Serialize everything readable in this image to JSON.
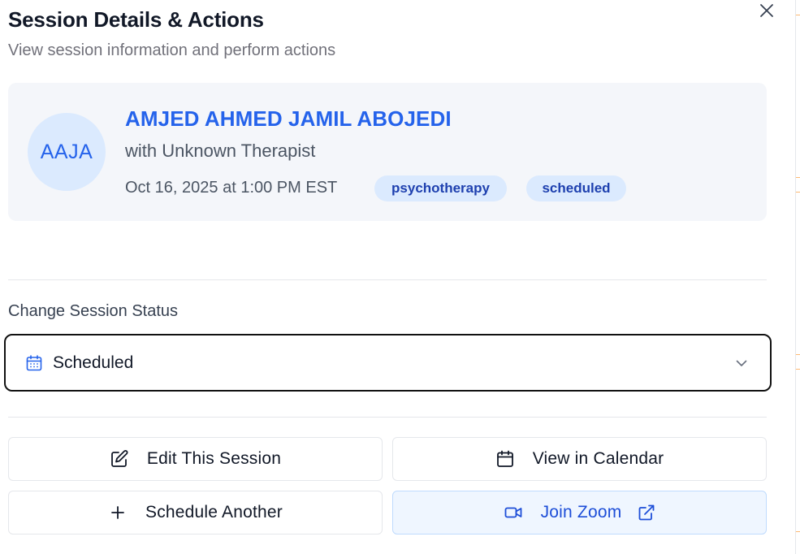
{
  "dialog": {
    "title": "Session Details & Actions",
    "subtitle": "View session information and perform actions",
    "close_icon": "close-icon"
  },
  "session": {
    "avatar_initials": "AAJA",
    "client_name": "AMJED AHMED JAMIL ABOJEDI",
    "therapist": "with Unknown Therapist",
    "datetime": "Oct 16, 2025 at 1:00 PM EST",
    "type_badge": "psychotherapy",
    "status_badge": "scheduled"
  },
  "status_change": {
    "label": "Change Session Status",
    "selected_value": "Scheduled",
    "selected_icon": "calendar-icon",
    "chevron_icon": "chevron-down-icon"
  },
  "actions": {
    "edit_label": "Edit This Session",
    "edit_icon": "edit-icon",
    "calendar_label": "View in Calendar",
    "calendar_icon": "calendar-icon",
    "schedule_label": "Schedule Another",
    "schedule_icon": "plus-icon",
    "zoom_label": "Join Zoom",
    "zoom_icon": "video-icon",
    "zoom_external_icon": "external-link-icon"
  },
  "colors": {
    "accent": "#2563eb",
    "card_bg": "#f4f6fa",
    "badge_bg": "#dbeafe",
    "badge_text": "#1e40af",
    "zoom_bg": "#eff6ff"
  }
}
